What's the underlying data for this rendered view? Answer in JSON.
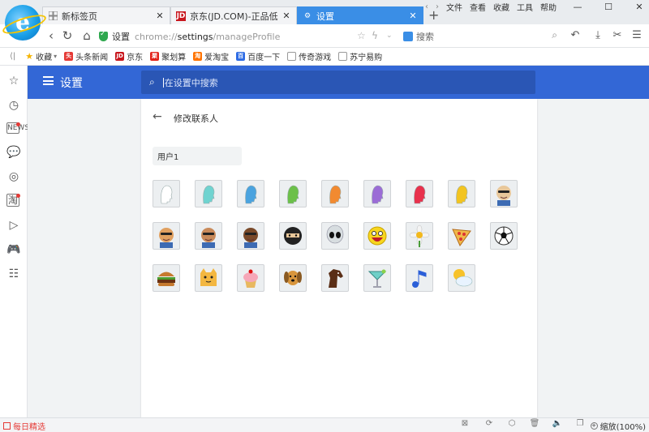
{
  "tabs": [
    {
      "title": "新标签页",
      "icon": "grid-icon",
      "active": false
    },
    {
      "title": "京东(JD.COM)-正品低价、品质保障",
      "icon": "jd-icon",
      "active": false
    },
    {
      "title": "设置",
      "icon": "gear-icon",
      "active": true
    }
  ],
  "topmenu": [
    "文件",
    "查看",
    "收藏",
    "工具",
    "帮助"
  ],
  "address": {
    "site_label": "设置",
    "scheme": "chrome://",
    "host": "settings",
    "path": "/manageProfile"
  },
  "search_placeholder": "搜索",
  "bookmarks": [
    {
      "label": "收藏",
      "icon": "star-icon",
      "color": "#f5b400"
    },
    {
      "label": "头条新闻",
      "icon": "toutiao-icon",
      "color": "#e53935"
    },
    {
      "label": "京东",
      "icon": "jd-icon",
      "color": "#c8161d"
    },
    {
      "label": "聚划算",
      "icon": "juhuasuan-icon",
      "color": "#e2231a"
    },
    {
      "label": "爱淘宝",
      "icon": "taobao-icon",
      "color": "#ff7300"
    },
    {
      "label": "百度一下",
      "icon": "baidu-icon",
      "color": "#2d6be4"
    },
    {
      "label": "传奇游戏",
      "icon": "page-icon",
      "color": "#999999"
    },
    {
      "label": "苏宁易购",
      "icon": "page-icon",
      "color": "#999999"
    }
  ],
  "settings": {
    "header_title": "设置",
    "search_placeholder": "在设置中搜索",
    "subpage_title": "修改联系人",
    "profile_name": "用户1"
  },
  "avatars": [
    {
      "name": "avatar-generic-white",
      "kind": "head",
      "color": "#ffffff"
    },
    {
      "name": "avatar-generic-aqua",
      "kind": "head",
      "color": "#6fd3d0"
    },
    {
      "name": "avatar-generic-blue",
      "kind": "head",
      "color": "#4aa3df"
    },
    {
      "name": "avatar-generic-green",
      "kind": "head",
      "color": "#6cc04a"
    },
    {
      "name": "avatar-generic-orange",
      "kind": "head",
      "color": "#f28a30"
    },
    {
      "name": "avatar-generic-purple",
      "kind": "head",
      "color": "#9b6cd6"
    },
    {
      "name": "avatar-generic-red",
      "kind": "head",
      "color": "#e8314d"
    },
    {
      "name": "avatar-generic-yellow",
      "kind": "head",
      "color": "#f2c420"
    },
    {
      "name": "avatar-secret-agent",
      "kind": "face",
      "color": "#e8c79a"
    },
    {
      "name": "avatar-superhero",
      "kind": "face",
      "color": "#e0a060"
    },
    {
      "name": "avatar-volleyball-player",
      "kind": "face",
      "color": "#c98a5a"
    },
    {
      "name": "avatar-businessman",
      "kind": "face",
      "color": "#7a4a2a"
    },
    {
      "name": "avatar-ninja",
      "kind": "ninja",
      "color": "#222222"
    },
    {
      "name": "avatar-alien",
      "kind": "alien",
      "color": "#d7dde0"
    },
    {
      "name": "avatar-awesome",
      "kind": "smile",
      "color": "#f7d51e"
    },
    {
      "name": "avatar-flower",
      "kind": "flower",
      "color": "#f4f4f4"
    },
    {
      "name": "avatar-pizza",
      "kind": "pizza",
      "color": "#f0b84a"
    },
    {
      "name": "avatar-soccer",
      "kind": "ball",
      "color": "#ffffff"
    },
    {
      "name": "avatar-burger",
      "kind": "burger",
      "color": "#c67a2e"
    },
    {
      "name": "avatar-cat",
      "kind": "cat",
      "color": "#f3b741"
    },
    {
      "name": "avatar-cupcake",
      "kind": "cupcake",
      "color": "#f6a7b8"
    },
    {
      "name": "avatar-dog",
      "kind": "dog",
      "color": "#d8953c"
    },
    {
      "name": "avatar-horse",
      "kind": "horse",
      "color": "#5a2e16"
    },
    {
      "name": "avatar-margarita",
      "kind": "glass",
      "color": "#6fd0c8"
    },
    {
      "name": "avatar-note",
      "kind": "note",
      "color": "#2b5fd8"
    },
    {
      "name": "avatar-sun-cloud",
      "kind": "sun",
      "color": "#f7c22a"
    }
  ],
  "status": {
    "daily_label": "每日精选",
    "zoom_label": "缩放(100%)"
  }
}
